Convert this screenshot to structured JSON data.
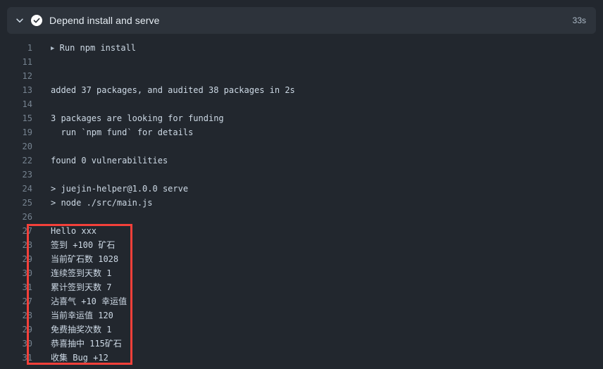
{
  "header": {
    "chevron_icon": "chevron-down-icon",
    "status_icon": "check-circle-icon",
    "title": "Depend install and serve",
    "duration": "33s"
  },
  "log": {
    "lines": [
      {
        "number": "1",
        "text": "▶ Run npm install"
      },
      {
        "number": "11",
        "text": ""
      },
      {
        "number": "12",
        "text": ""
      },
      {
        "number": "13",
        "text": "added 37 packages, and audited 38 packages in 2s"
      },
      {
        "number": "14",
        "text": ""
      },
      {
        "number": "15",
        "text": "3 packages are looking for funding"
      },
      {
        "number": "19",
        "text": "  run `npm fund` for details"
      },
      {
        "number": "20",
        "text": ""
      },
      {
        "number": "22",
        "text": "found 0 vulnerabilities"
      },
      {
        "number": "23",
        "text": ""
      },
      {
        "number": "24",
        "text": "> juejin-helper@1.0.0 serve"
      },
      {
        "number": "25",
        "text": "> node ./src/main.js"
      },
      {
        "number": "26",
        "text": ""
      },
      {
        "number": "27",
        "text": "Hello xxx"
      },
      {
        "number": "28",
        "text": "签到 +100 矿石"
      },
      {
        "number": "29",
        "text": "当前矿石数 1028"
      },
      {
        "number": "30",
        "text": "连续签到天数 1"
      },
      {
        "number": "31",
        "text": "累计签到天数 7"
      },
      {
        "number": "27",
        "text": "沾喜气 +10 幸运值"
      },
      {
        "number": "28",
        "text": "当前幸运值 120"
      },
      {
        "number": "29",
        "text": "免费抽奖次数 1"
      },
      {
        "number": "30",
        "text": "恭喜抽中 115矿石"
      },
      {
        "number": "31",
        "text": "收集 Bug +12"
      }
    ]
  },
  "annotation": {
    "highlight_color": "#f4403a"
  }
}
